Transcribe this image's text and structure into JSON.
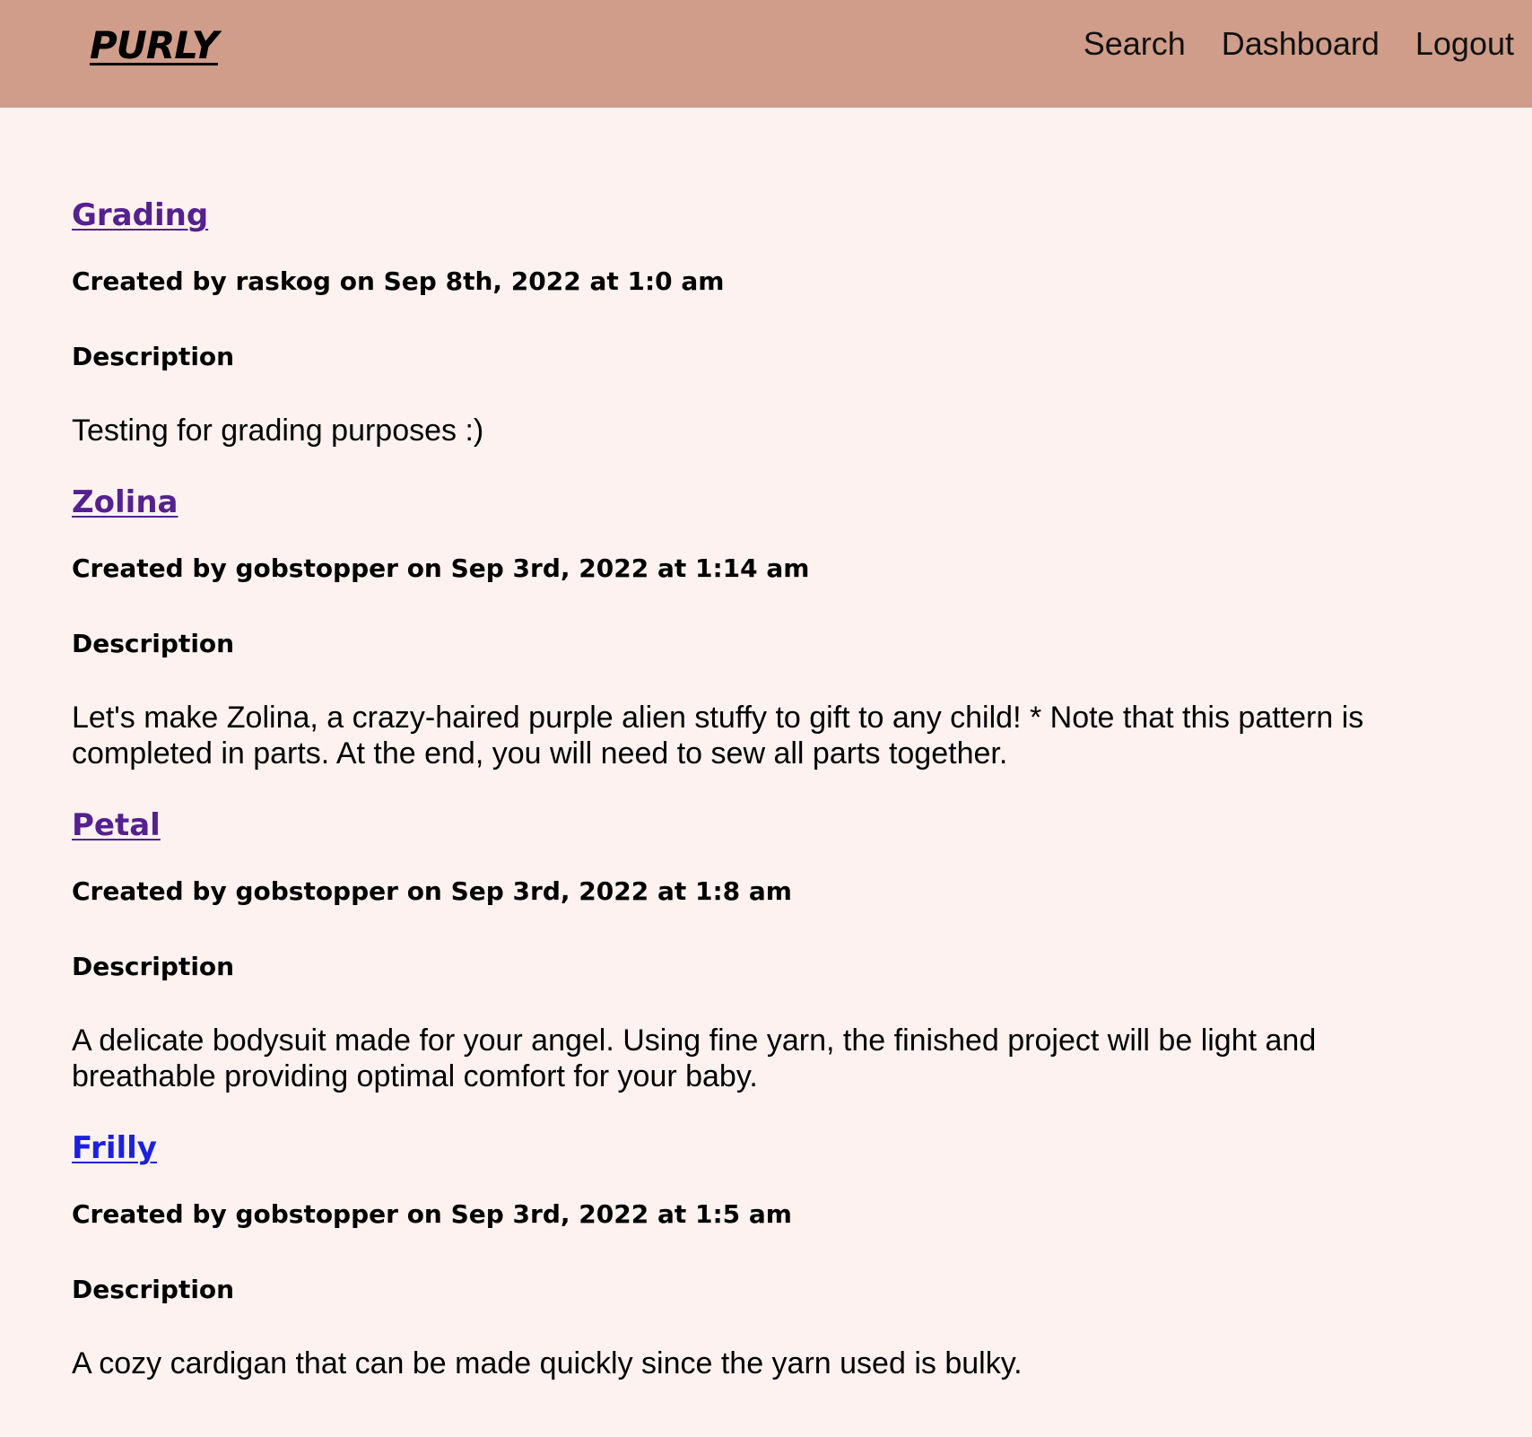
{
  "header": {
    "brand": "PURLY",
    "nav": {
      "search": "Search",
      "dashboard": "Dashboard",
      "logout": "Logout"
    }
  },
  "patterns": [
    {
      "title": "Grading",
      "meta": "Created by raskog on Sep 8th, 2022 at 1:0 am",
      "description_heading": "Description",
      "description": "Testing for grading purposes :)",
      "link_state": "visited"
    },
    {
      "title": "Zolina",
      "meta": "Created by gobstopper on Sep 3rd, 2022 at 1:14 am",
      "description_heading": "Description",
      "description": "Let's make Zolina, a crazy-haired purple alien stuffy to gift to any child! * Note that this pattern is completed in parts. At the end, you will need to sew all parts together.",
      "link_state": "visited"
    },
    {
      "title": "Petal",
      "meta": "Created by gobstopper on Sep 3rd, 2022 at 1:8 am",
      "description_heading": "Description",
      "description": "A delicate bodysuit made for your angel. Using fine yarn, the finished project will be light and breathable providing optimal comfort for your baby.",
      "link_state": "visited"
    },
    {
      "title": "Frilly",
      "meta": "Created by gobstopper on Sep 3rd, 2022 at 1:5 am",
      "description_heading": "Description",
      "description": "A cozy cardigan that can be made quickly since the yarn used is bulky.",
      "link_state": "unvisited"
    }
  ],
  "colors": {
    "header_bg": "#cf9d89",
    "page_bg": "#fdf2ef",
    "visited_link": "#55208f",
    "unvisited_link": "#1d20e0"
  }
}
